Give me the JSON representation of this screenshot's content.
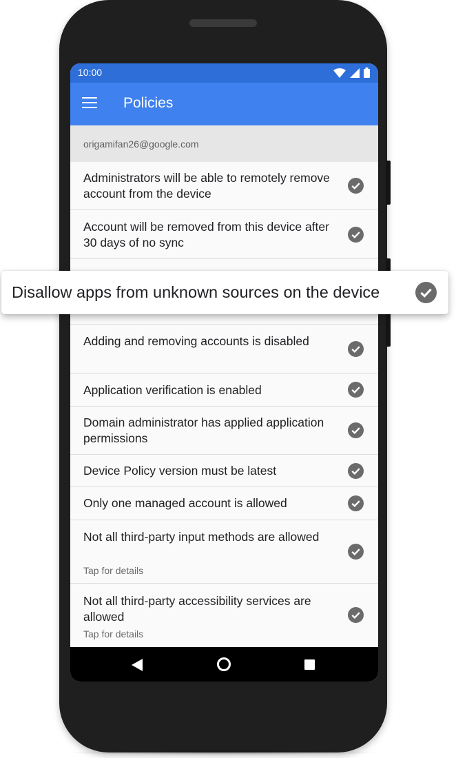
{
  "status_bar": {
    "time": "10:00",
    "icons": [
      "wifi-icon",
      "signal-icon",
      "battery-icon"
    ]
  },
  "app_bar": {
    "menu_icon": "menu-icon",
    "title": "Policies"
  },
  "account": {
    "email": "origamifan26@google.com"
  },
  "policies": [
    {
      "label": "Administrators will be able to remotely remove account from the device",
      "status": "check-icon"
    },
    {
      "label": "Account will be removed from this device after 30 days of no sync",
      "status": "check-icon"
    },
    {
      "label": "Adding and removing accounts is disabled",
      "status": "check-icon"
    },
    {
      "label": "Application verification is enabled",
      "status": "check-icon"
    },
    {
      "label": "Domain administrator has applied application permissions",
      "status": "check-icon"
    },
    {
      "label": "Device Policy version must be latest",
      "status": "check-icon"
    },
    {
      "label": "Only one managed account is allowed",
      "status": "check-icon"
    },
    {
      "label": "Not all third-party input methods are allowed",
      "sublabel": "Tap for details",
      "status": "check-icon"
    },
    {
      "label": "Not all third-party accessibility services are allowed",
      "sublabel": "Tap for details",
      "status": "check-icon"
    }
  ],
  "highlighted_policy": {
    "label": "Disallow apps from unknown sources on the device",
    "status": "check-icon"
  },
  "nav_bar": {
    "buttons": [
      "back-icon",
      "home-icon",
      "recents-icon"
    ]
  },
  "colors": {
    "status_bar": "#2e6ed8",
    "app_bar": "#3f81ee",
    "check": "#6b6b6b",
    "nav_bar": "#000000"
  }
}
